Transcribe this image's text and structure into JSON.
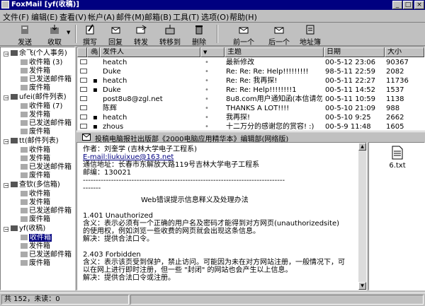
{
  "window": {
    "title": "FoxMail [yf(收稿)]"
  },
  "menu": [
    "文件(F)",
    "编辑(E)",
    "查看(V)",
    "帐户(A)",
    "邮件(M)",
    "邮箱(B)",
    "工具(T)",
    "选项(O)",
    "帮助(H)"
  ],
  "toolbar": {
    "send": "发送",
    "receive": "收取",
    "compose": "撰写",
    "reply": "回复",
    "forward": "转发",
    "move": "转移到",
    "delete": "删除",
    "prev": "前一个",
    "next": "后一个",
    "address_book": "地址簿"
  },
  "tree": {
    "accounts": [
      {
        "name": "余飞(个人事务)",
        "folders": [
          "收件箱 (3)",
          "发件箱",
          "已发送邮件箱",
          "废件箱"
        ]
      },
      {
        "name": "ufei(邮件列表)",
        "folders": [
          "收件箱 (7)",
          "发件箱",
          "已发送邮件箱",
          "废件箱"
        ]
      },
      {
        "name": "tt(邮件列表)",
        "folders": [
          "收件箱",
          "发件箱",
          "已发送邮件箱",
          "废件箱"
        ]
      },
      {
        "name": "查钦(多信箱)",
        "folders": [
          "收件箱",
          "发件箱",
          "已发送邮件箱",
          "废件箱"
        ]
      },
      {
        "name": "yf(收稿)",
        "folders": [
          "收件箱",
          "发件箱",
          "已发送邮件箱",
          "废件箱"
        ]
      }
    ]
  },
  "list": {
    "columns": {
      "sender": "发件人",
      "subject": "主题",
      "date": "日期",
      "size": "大小"
    },
    "rows": [
      {
        "sender": "heatch",
        "subject": "最新修改",
        "date": "00-5-12 23:06",
        "size": "90367"
      },
      {
        "sender": "Duke",
        "subject": "Re: Re: Re: Help!!!!!!!!!",
        "date": "98-5-11 22:59",
        "size": "2082"
      },
      {
        "sender": "heatch",
        "subject": "Re: Re: 我再探!",
        "date": "00-5-11 22:27",
        "size": "11736"
      },
      {
        "sender": "Duke",
        "subject": "Re: Re: Help!!!!!!!!1",
        "date": "00-5-11 14:52",
        "size": "1537"
      },
      {
        "sender": "post8u8@zgl.net",
        "subject": "8u8.com用户通知函(本信请勿...",
        "date": "00-5-11 10:59",
        "size": "1138"
      },
      {
        "sender": "陈辉",
        "subject": "THANKS A LOT!!!!",
        "date": "00-5-10 21:09",
        "size": "988"
      },
      {
        "sender": "heatch",
        "subject": "我再探!",
        "date": "00-5-10  9:25",
        "size": "2662"
      },
      {
        "sender": "zhous",
        "subject": "十二万分的感谢您的赏容! :)",
        "date": "00-5-9 11:48",
        "size": "1605"
      },
      {
        "sender": "",
        "subject": "投稿电脑报社出版部《2000电脑应用精华本》编辑部(网络版",
        "date": "",
        "size": ""
      }
    ]
  },
  "preview": {
    "subject_bar": "投稿电脑报社出版部《2000电脑应用精华本》编辑部(网络版)",
    "lines": [
      "作者：刘奎学 (吉林大学电子工程系)",
      "E-mail:liukuixue@163.net",
      "通信地址：长春市东解放大路119号吉林大学电子工程系",
      "邮编：130021",
      "-------------------------------------------------------------------------------",
      "-------",
      "",
      "Web错误提示信息释义及处理办法",
      "",
      "1.401 Unauthorized",
      "含义：表示必须有一个正确的用户名及密码才能得到对方网页(unauthorizedsite)",
      "的使用权，例如浏览一些收费的网页就会出现这条信息。",
      "解决：提供合法口令。",
      "",
      "2.403 Forbidden",
      "含义：表示该页受到保护，禁止访问。可能因为未在对方网站注册，一般情况下，可",
      "以在网上进行即时注册，但一些 \"封闭\" 的网站也会产生以上信息。",
      "解决：提供合法口令或注册。"
    ]
  },
  "attachment": {
    "filename": "6.txt"
  },
  "status": {
    "text": "共 152，未读：0"
  }
}
